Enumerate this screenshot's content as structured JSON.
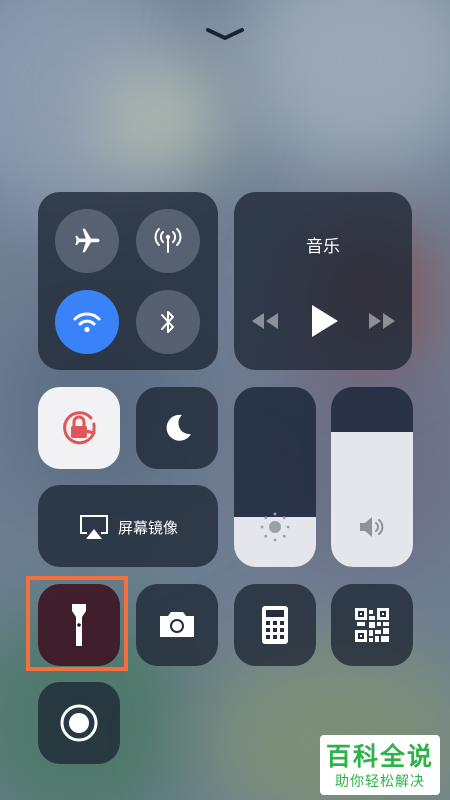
{
  "music": {
    "title": "音乐"
  },
  "screen_mirroring": {
    "label": "屏幕镜像"
  },
  "sliders": {
    "brightness_level": 0.28,
    "volume_level": 0.75
  },
  "watermark": {
    "line1": "百科全说",
    "line2": "助你轻松解决"
  },
  "colors": {
    "wifi_active": "#3a82f7",
    "highlight": "#f3703e",
    "watermark": "#2fb24a",
    "rotation_lock": "#e0555a"
  },
  "icons": {
    "dismiss": "chevron-down-icon",
    "airplane": "airplane-icon",
    "cellular": "antenna-icon",
    "wifi": "wifi-icon",
    "bluetooth": "bluetooth-icon",
    "rewind": "rewind-icon",
    "play": "play-icon",
    "forward": "forward-icon",
    "rotation_lock": "rotation-lock-icon",
    "do_not_disturb": "moon-icon",
    "screen_mirroring": "airplay-icon",
    "brightness": "sun-icon",
    "volume": "speaker-icon",
    "flashlight": "flashlight-icon",
    "camera": "camera-icon",
    "calculator": "calculator-icon",
    "qr_scanner": "qr-code-icon",
    "screen_record": "record-icon"
  }
}
